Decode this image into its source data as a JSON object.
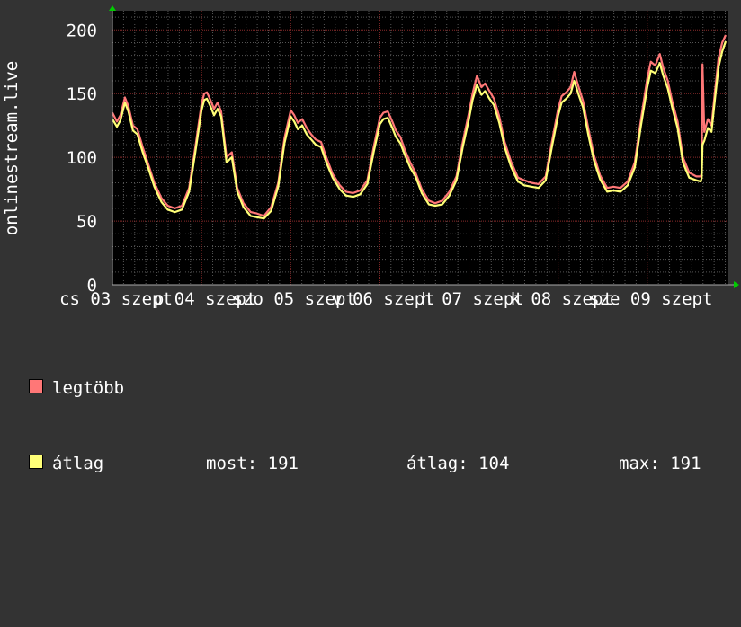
{
  "chart_data": {
    "type": "line",
    "ylabel": "onlinestream.live",
    "ylim": [
      0,
      215
    ],
    "yticks": [
      0,
      50,
      100,
      150,
      200
    ],
    "xlim": [
      0,
      6.9
    ],
    "xtick_labels": [
      {
        "x": 0.0,
        "label": "cs 03 szept"
      },
      {
        "x": 1.0,
        "label": "p 04 szept"
      },
      {
        "x": 2.0,
        "label": "szo 05 szept"
      },
      {
        "x": 3.0,
        "label": "v 06 szept"
      },
      {
        "x": 4.0,
        "label": "h 07 szept"
      },
      {
        "x": 5.0,
        "label": "k 08 szept"
      },
      {
        "x": 6.0,
        "label": "sze 09 szept"
      }
    ],
    "grid": true,
    "colors": {
      "max": "#ff7777",
      "avg": "#ffff77",
      "grid_major": "#8a2a2a",
      "grid_minor": "#555555",
      "axis": "#aaaaaa",
      "plot_bg": "#000000",
      "arrow": "#00cc00"
    },
    "series": [
      {
        "name": "legtöbb",
        "color": "#ff7777",
        "x": [
          0.0,
          0.05,
          0.09,
          0.14,
          0.18,
          0.23,
          0.28,
          0.34,
          0.4,
          0.47,
          0.55,
          0.62,
          0.7,
          0.78,
          0.86,
          0.93,
          1.0,
          1.03,
          1.06,
          1.1,
          1.14,
          1.18,
          1.22,
          1.28,
          1.34,
          1.4,
          1.47,
          1.55,
          1.62,
          1.7,
          1.78,
          1.86,
          1.93,
          2.0,
          2.04,
          2.08,
          2.13,
          2.18,
          2.23,
          2.28,
          2.34,
          2.4,
          2.47,
          2.55,
          2.62,
          2.7,
          2.78,
          2.86,
          2.93,
          3.0,
          3.04,
          3.09,
          3.14,
          3.18,
          3.23,
          3.28,
          3.34,
          3.4,
          3.47,
          3.55,
          3.62,
          3.7,
          3.78,
          3.86,
          3.93,
          4.0,
          4.04,
          4.09,
          4.14,
          4.18,
          4.23,
          4.28,
          4.34,
          4.4,
          4.47,
          4.55,
          4.62,
          4.7,
          4.78,
          4.86,
          4.93,
          5.0,
          5.04,
          5.09,
          5.14,
          5.18,
          5.23,
          5.28,
          5.34,
          5.4,
          5.47,
          5.55,
          5.62,
          5.7,
          5.78,
          5.86,
          5.93,
          6.0,
          6.04,
          6.09,
          6.14,
          6.18,
          6.23,
          6.28,
          6.34,
          6.4,
          6.47,
          6.55,
          6.6,
          6.61,
          6.62,
          6.64,
          6.68,
          6.72,
          6.76,
          6.8,
          6.84,
          6.88
        ],
        "y": [
          135,
          128,
          133,
          147,
          140,
          125,
          122,
          108,
          95,
          80,
          68,
          62,
          60,
          62,
          76,
          108,
          142,
          150,
          151,
          145,
          138,
          143,
          136,
          100,
          104,
          76,
          64,
          57,
          56,
          54,
          61,
          80,
          115,
          137,
          133,
          127,
          130,
          123,
          118,
          114,
          112,
          100,
          87,
          78,
          73,
          72,
          74,
          82,
          108,
          131,
          135,
          136,
          128,
          121,
          116,
          106,
          96,
          88,
          75,
          66,
          64,
          66,
          73,
          85,
          112,
          135,
          150,
          164,
          155,
          158,
          152,
          146,
          132,
          112,
          97,
          84,
          82,
          80,
          79,
          85,
          112,
          138,
          148,
          151,
          155,
          167,
          155,
          144,
          122,
          102,
          86,
          76,
          77,
          76,
          81,
          96,
          130,
          162,
          175,
          172,
          181,
          170,
          160,
          144,
          128,
          100,
          88,
          85,
          85,
          88,
          173,
          120,
          130,
          125,
          152,
          178,
          190,
          196
        ]
      },
      {
        "name": "átlag",
        "color": "#ffff77",
        "x": [
          0.0,
          0.05,
          0.09,
          0.14,
          0.18,
          0.23,
          0.28,
          0.34,
          0.4,
          0.47,
          0.55,
          0.62,
          0.7,
          0.78,
          0.86,
          0.93,
          1.0,
          1.03,
          1.06,
          1.1,
          1.14,
          1.18,
          1.22,
          1.28,
          1.34,
          1.4,
          1.47,
          1.55,
          1.62,
          1.7,
          1.78,
          1.86,
          1.93,
          2.0,
          2.04,
          2.08,
          2.13,
          2.18,
          2.23,
          2.28,
          2.34,
          2.4,
          2.47,
          2.55,
          2.62,
          2.7,
          2.78,
          2.86,
          2.93,
          3.0,
          3.04,
          3.09,
          3.14,
          3.18,
          3.23,
          3.28,
          3.34,
          3.4,
          3.47,
          3.55,
          3.62,
          3.7,
          3.78,
          3.86,
          3.93,
          4.0,
          4.04,
          4.09,
          4.14,
          4.18,
          4.23,
          4.28,
          4.34,
          4.4,
          4.47,
          4.55,
          4.62,
          4.7,
          4.78,
          4.86,
          4.93,
          5.0,
          5.04,
          5.09,
          5.14,
          5.18,
          5.23,
          5.28,
          5.34,
          5.4,
          5.47,
          5.55,
          5.62,
          5.7,
          5.78,
          5.86,
          5.93,
          6.0,
          6.04,
          6.09,
          6.14,
          6.18,
          6.23,
          6.28,
          6.34,
          6.4,
          6.47,
          6.55,
          6.6,
          6.61,
          6.62,
          6.64,
          6.68,
          6.72,
          6.76,
          6.8,
          6.84,
          6.88
        ],
        "y": [
          130,
          124,
          129,
          143,
          136,
          121,
          118,
          104,
          92,
          77,
          65,
          59,
          57,
          59,
          73,
          104,
          137,
          145,
          146,
          140,
          133,
          138,
          132,
          96,
          100,
          73,
          61,
          54,
          53,
          52,
          58,
          77,
          111,
          132,
          128,
          122,
          125,
          118,
          114,
          110,
          108,
          96,
          84,
          75,
          70,
          69,
          71,
          79,
          104,
          126,
          130,
          131,
          123,
          116,
          111,
          102,
          92,
          85,
          72,
          63,
          62,
          63,
          70,
          82,
          108,
          130,
          145,
          157,
          149,
          152,
          146,
          141,
          127,
          108,
          93,
          81,
          78,
          77,
          76,
          82,
          108,
          133,
          143,
          146,
          150,
          160,
          149,
          139,
          117,
          98,
          83,
          73,
          74,
          73,
          78,
          92,
          125,
          155,
          168,
          166,
          174,
          164,
          154,
          139,
          123,
          96,
          84,
          82,
          81,
          84,
          110,
          113,
          123,
          120,
          146,
          171,
          183,
          191
        ]
      }
    ]
  },
  "legend": {
    "items": [
      {
        "label": "legtöbb",
        "color": "#ff7777"
      },
      {
        "label": "átlag",
        "color": "#ffff77"
      }
    ],
    "stats": {
      "now": "most: 191",
      "avg": "átlag: 104",
      "max": "max: 191"
    }
  }
}
